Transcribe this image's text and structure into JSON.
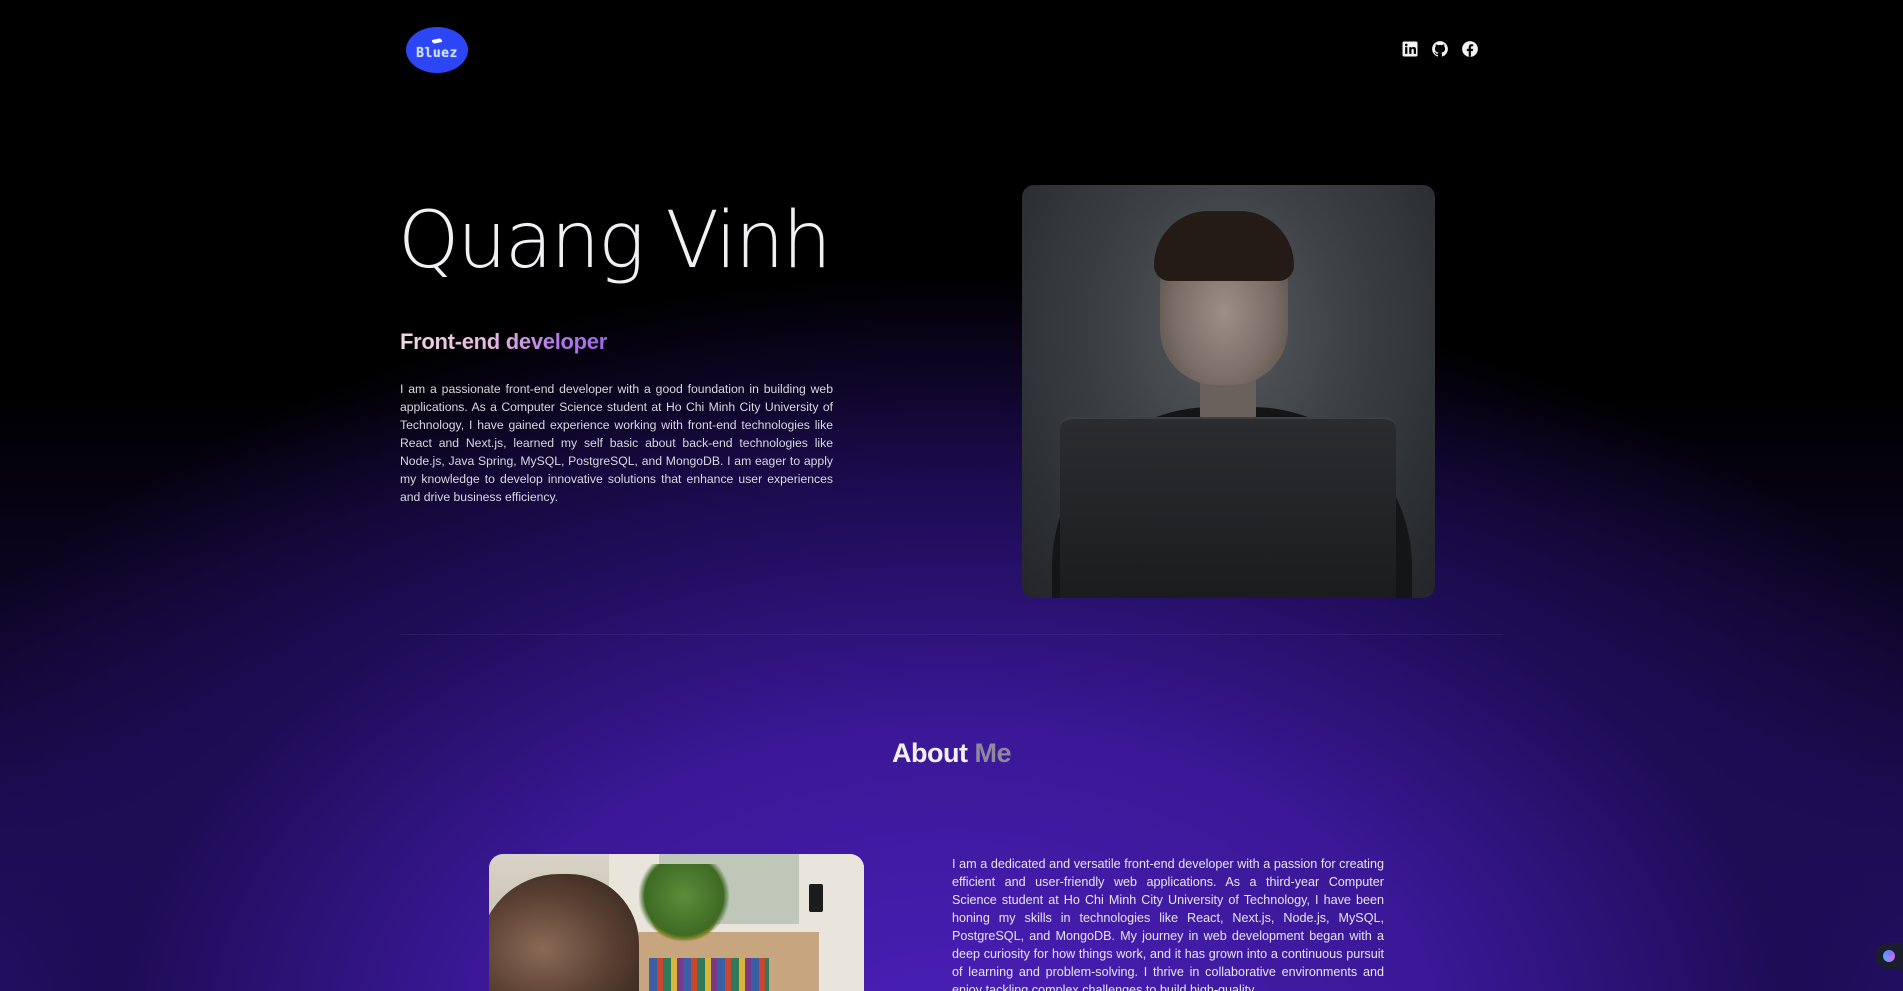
{
  "header": {
    "logo_text": "Bluez",
    "social": [
      {
        "name": "linkedin-icon"
      },
      {
        "name": "github-icon"
      },
      {
        "name": "facebook-icon"
      }
    ]
  },
  "hero": {
    "name": "Quang Vinh",
    "role": "Front-end developer",
    "description": "I am a passionate front-end developer with a good foundation in building web applications. As a Computer Science student at Ho Chi Minh City University of Technology, I have gained experience working with front-end technologies like React and Next.js, learned my self basic about back-end technologies like Node.js, Java Spring, MySQL, PostgreSQL, and MongoDB. I am eager to apply my knowledge to develop innovative solutions that enhance user experiences and drive business efficiency."
  },
  "about": {
    "title_main": "About",
    "title_accent": "Me",
    "text": "I am a dedicated and versatile front-end developer with a passion for creating efficient and user-friendly web applications. As a third-year Computer Science student at Ho Chi Minh City University of Technology, I have been honing my skills in technologies like React, Next.js, Node.js, MySQL, PostgreSQL, and MongoDB. My journey in web development began with a deep curiosity for how things work, and it has grown into a continuous pursuit of learning and problem-solving. I thrive in collaborative environments and enjoy tackling complex challenges to build high-quality"
  },
  "colors": {
    "logo_bg": "#2d46f5",
    "accent_purple": "#9d68e8",
    "background_glow": "#4a1fb8"
  }
}
